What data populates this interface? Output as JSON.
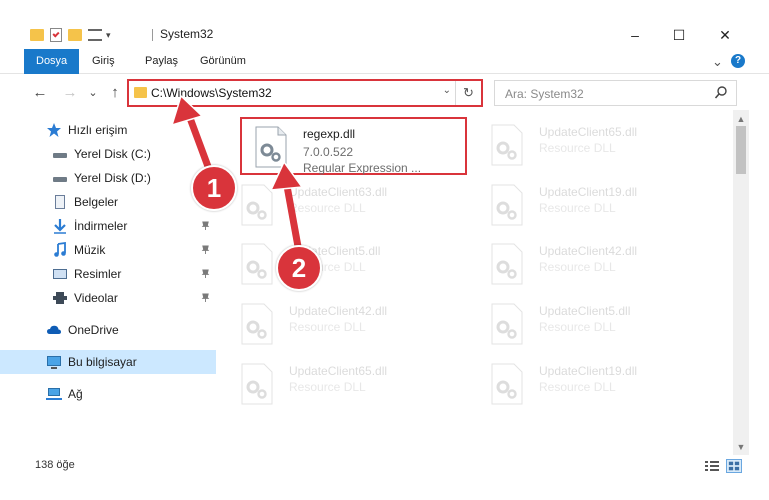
{
  "window": {
    "title": "System32",
    "minimize_label": "–",
    "maximize_label": "☐",
    "close_label": "✕"
  },
  "ribbon": {
    "tabs": [
      {
        "label": "Dosya"
      },
      {
        "label": "Giriş"
      },
      {
        "label": "Paylaş"
      },
      {
        "label": "Görünüm"
      }
    ],
    "expand_label": "⌄",
    "help_label": "?"
  },
  "address": {
    "path": "C:\\Windows\\System32",
    "back_label": "←",
    "forward_label": "→",
    "recent_label": "⌄",
    "up_label": "↑",
    "dropdown_label": "⌄",
    "refresh_label": "↻"
  },
  "search": {
    "placeholder": "Ara: System32"
  },
  "sidebar": {
    "items": [
      {
        "label": "Hızlı erişim",
        "icon": "star-icon"
      },
      {
        "label": "Yerel Disk (C:)",
        "icon": "drive-icon"
      },
      {
        "label": "Yerel Disk (D:)",
        "icon": "drive-icon"
      },
      {
        "label": "Belgeler",
        "icon": "documents-icon"
      },
      {
        "label": "İndirmeler",
        "icon": "download-icon"
      },
      {
        "label": "Müzik",
        "icon": "music-icon"
      },
      {
        "label": "Resimler",
        "icon": "pictures-icon"
      },
      {
        "label": "Videolar",
        "icon": "video-icon"
      },
      {
        "label": "OneDrive",
        "icon": "cloud-icon"
      },
      {
        "label": "Bu bilgisayar",
        "icon": "computer-icon"
      },
      {
        "label": "Ağ",
        "icon": "network-icon"
      }
    ]
  },
  "files": [
    {
      "name": "regexp.dll",
      "version": "7.0.0.522",
      "desc": "Regular Expression ..."
    },
    {
      "name": "UpdateClient65.dll",
      "desc": "Resource DLL"
    },
    {
      "name": "UpdateClient63.dll",
      "desc": "Resource DLL"
    },
    {
      "name": "UpdateClient19.dll",
      "desc": "Resource DLL"
    },
    {
      "name": "UpdateClient5.dll",
      "desc": "Resource DLL"
    },
    {
      "name": "UpdateClient42.dll",
      "desc": "Resource DLL"
    },
    {
      "name": "UpdateClient42.dll",
      "desc": "Resource DLL"
    },
    {
      "name": "UpdateClient5.dll",
      "desc": "Resource DLL"
    },
    {
      "name": "UpdateClient65.dll",
      "desc": "Resource DLL"
    },
    {
      "name": "UpdateClient19.dll",
      "desc": "Resource DLL"
    }
  ],
  "status": {
    "count": "138 öğe"
  },
  "annotations": {
    "step1": "1",
    "step2": "2"
  },
  "colors": {
    "accent": "#1979ca",
    "highlight": "#d9343b",
    "selected_bg": "#cce8ff"
  }
}
